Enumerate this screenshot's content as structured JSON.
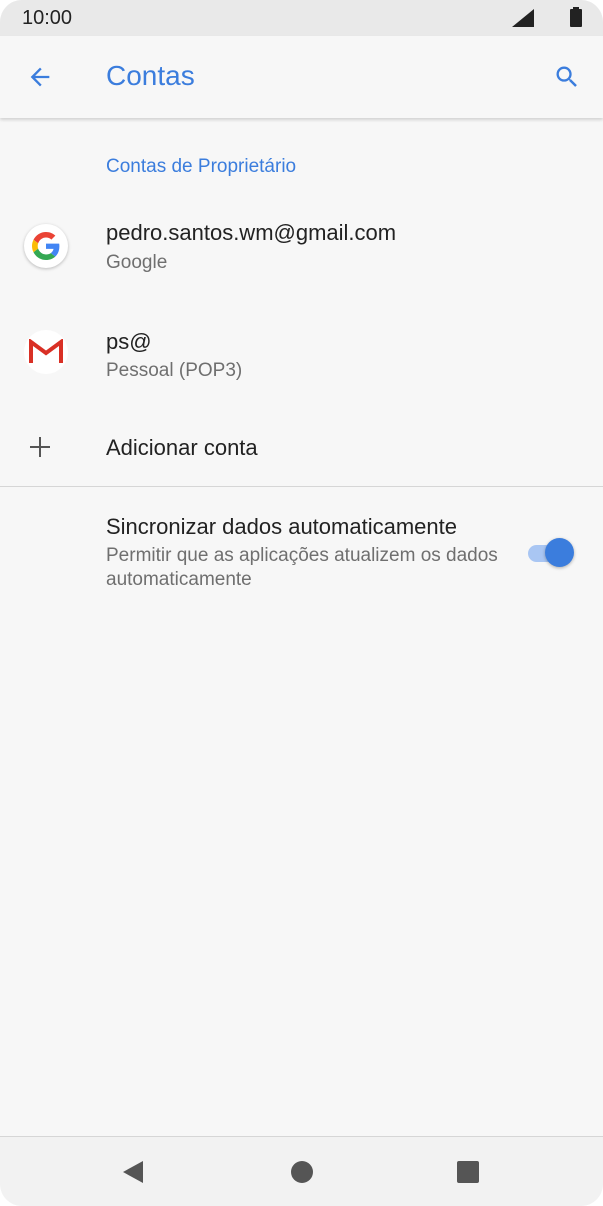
{
  "status_bar": {
    "time": "10:00",
    "icons": [
      "signal-icon",
      "battery-icon"
    ]
  },
  "app_bar": {
    "title": "Contas",
    "back_icon": "arrow-back-icon",
    "search_icon": "search-icon"
  },
  "section": {
    "header": "Contas de Proprietário"
  },
  "accounts": [
    {
      "title": "pedro.santos.wm@gmail.com",
      "subtitle": "Google",
      "icon": "google-icon"
    },
    {
      "title": "ps@",
      "subtitle": "Pessoal (POP3)",
      "icon": "gmail-icon"
    }
  ],
  "add_account": {
    "label": "Adicionar conta",
    "icon": "plus-icon"
  },
  "sync": {
    "title": "Sincronizar dados automaticamente",
    "description": "Permitir que as aplicações atualizem os dados automaticamente",
    "enabled": true
  },
  "nav_bar": {
    "icons": [
      "nav-back-icon",
      "nav-home-icon",
      "nav-recents-icon"
    ]
  },
  "colors": {
    "accent": "#3b7ddd",
    "toggle_track": "#a9c6f3",
    "background": "#f7f7f7"
  }
}
